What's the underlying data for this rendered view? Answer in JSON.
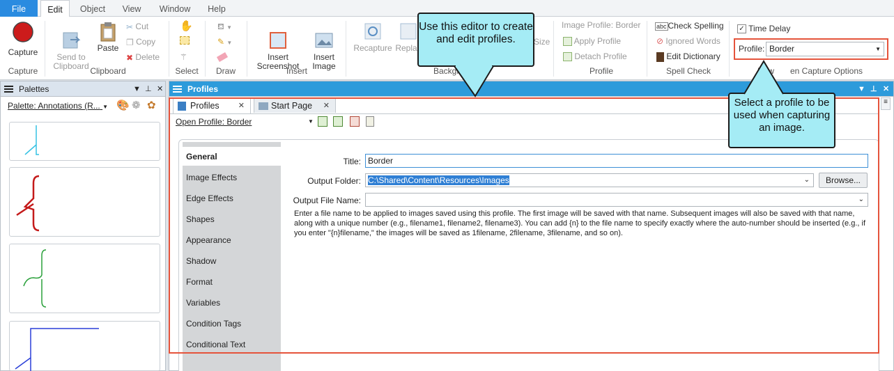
{
  "menu": [
    "File",
    "Edit",
    "Object",
    "View",
    "Window",
    "Help"
  ],
  "ribbon": {
    "capture": {
      "label": "Capture",
      "group": "Capture"
    },
    "clipboard": {
      "send": "Send to\nClipboard",
      "paste": "Paste",
      "cut": "Cut",
      "copy": "Copy",
      "delete": "Delete",
      "group": "Clipboard"
    },
    "select": {
      "group": "Select"
    },
    "draw": {
      "group": "Draw"
    },
    "insert": {
      "screenshot": "Insert\nScreenshot",
      "image": "Insert\nImage",
      "group": "Insert"
    },
    "background": {
      "recapture": "Recapture",
      "replace": "Replac",
      "size": "Size",
      "group": "Backgro"
    },
    "profile": {
      "title": "Image Profile: Border",
      "apply": "Apply Profile",
      "detach": "Detach Profile",
      "group": "Profile"
    },
    "spell": {
      "check": "Check Spelling",
      "ignored": "Ignored Words",
      "dictionary": "Edit Dictionary",
      "group": "Spell Check"
    },
    "capture_options": {
      "time_delay": "Time Delay",
      "profile_label": "Profile:",
      "profile_value": "Border",
      "group_left": "New",
      "group_right": "en Capture Options"
    }
  },
  "palettes": {
    "title": "Palettes",
    "selector": "Palette: Annotations (R..."
  },
  "profiles_panel": {
    "title": "Profiles",
    "tabs": [
      {
        "label": "Profiles"
      },
      {
        "label": "Start Page"
      }
    ],
    "open_profile": "Open Profile: Border",
    "nav": [
      "General",
      "Image Effects",
      "Edge Effects",
      "Shapes",
      "Appearance",
      "Shadow",
      "Format",
      "Variables",
      "Condition Tags",
      "Conditional Text"
    ],
    "fields": {
      "title_label": "Title:",
      "title_value": "Border",
      "folder_label": "Output Folder:",
      "folder_value": "C:\\Shared\\Content\\Resources\\Images",
      "filename_label": "Output File Name:",
      "filename_value": "",
      "browse": "Browse..."
    },
    "help_text": "Enter a file name to be applied to images saved using this profile. The first image will be saved with that name. Subsequent images will also be saved with that name, along with a unique number (e.g., filename1, filename2, filename3). You can add {n} to the file name to specify exactly where the auto-number should be inserted (e.g., if you enter \"{n}filename,\" the images will be saved as 1filename, 2filename, 3filename, and so on)."
  },
  "callouts": {
    "editor": "Use this editor to create and edit profiles.",
    "profile": "Select a profile to be used when capturing an image."
  },
  "colors": {
    "accent": "#2d9bdb",
    "callout": "#a5ecf5",
    "highlight": "#e5533b"
  }
}
